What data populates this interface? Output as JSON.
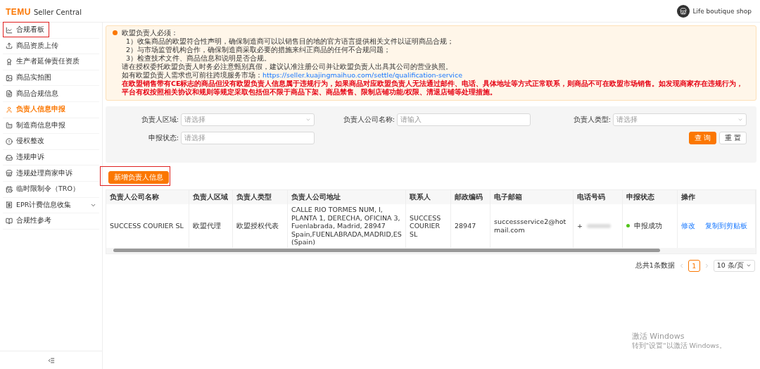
{
  "header": {
    "logo": "TEMU",
    "product": "Seller Central",
    "shop": "Life boutique shop"
  },
  "sidebar": {
    "items": [
      {
        "label": "合规看板",
        "selected": false,
        "highlighted": true
      },
      {
        "label": "商品资质上传",
        "selected": false,
        "highlighted": false
      },
      {
        "label": "生产者延伸责任资质",
        "selected": false,
        "highlighted": false
      },
      {
        "label": "商品实拍图",
        "selected": false,
        "highlighted": false
      },
      {
        "label": "商品合规信息",
        "selected": false,
        "highlighted": false
      },
      {
        "label": "负责人信息申报",
        "selected": true,
        "highlighted": false
      },
      {
        "label": "制造商信息申报",
        "selected": false,
        "highlighted": false
      },
      {
        "label": "侵权整改",
        "selected": false,
        "highlighted": false
      },
      {
        "label": "违规申诉",
        "selected": false,
        "highlighted": false
      },
      {
        "label": "违规处理商家申诉",
        "selected": false,
        "highlighted": false
      },
      {
        "label": "临时限制令（TRO）",
        "selected": false,
        "highlighted": false
      },
      {
        "label": "EPR计费信息收集",
        "selected": false,
        "highlighted": false,
        "expanded": false
      },
      {
        "label": "合规性参考",
        "selected": false,
        "highlighted": false
      }
    ]
  },
  "notice": {
    "title": "欧盟负责人必须：",
    "lines": [
      "1）收集商品的欧盟符合性声明，确保制造商可以以销售目的地的官方语言提供相关文件以证明商品合规；",
      "2）与市场监管机构合作，确保制造商采取必要的措施来纠正商品的任何不合规问题；",
      "3）检查技术文件、商品信息和说明是否合规。",
      "请在授权委托欧盟负责人时务必注意甄别真假，建议认准注册公司并让欧盟负责人出具其公司的营业执照。"
    ],
    "link_prefix": "如有欧盟负责人需求也可前往跨境服务市场：",
    "link": "https://seller.kuajingmaihuo.com/settle/qualification-service",
    "warning": "在欧盟销售带有CE标志的商品但没有欧盟负责人信息属于违规行为，如果商品对应欧盟负责人无法通过邮件、电话、具体地址等方式正常联系，则商品不可在欧盟市场销售。如发现商家存在违规行为，平台有权按照相关协议和规则等规定采取包括但不限于商品下架、商品禁售、限制店铺功能/权限、清退店铺等处理措施。"
  },
  "filters": [
    {
      "label": "负责人区域:",
      "placeholder": "请选择",
      "kind": "select"
    },
    {
      "label": "负责人公司名称:",
      "placeholder": "请输入",
      "kind": "input"
    },
    {
      "label": "负责人类型:",
      "placeholder": "请选择",
      "kind": "select"
    },
    {
      "label": "申报状态:",
      "placeholder": "请选择",
      "kind": "input"
    }
  ],
  "filter_buttons": [
    {
      "label": "查 询",
      "kind": "primary"
    },
    {
      "label": "重 置",
      "kind": "default"
    }
  ],
  "add_button": {
    "label": "新增负责人信息",
    "highlighted": true
  },
  "table": {
    "columns": [
      "负责人公司名称",
      "负责人区域",
      "负责人类型",
      "负责人公司地址",
      "联系人",
      "邮政编码",
      "电子邮箱",
      "电话号码",
      "申报状态",
      "操作"
    ],
    "rows": [
      {
        "company": "SUCCESS COURIER SL",
        "region": "欧盟代理",
        "type": "欧盟授权代表",
        "address": "CALLE RIO TORMES NUM, I, PLANTA 1, DERECHA, OFICINA 3, Fuenlabrada, Madrid, 28947 Spain,FUENLABRADA,MADRID,ES(Spain)",
        "contact": "SUCCESS COURIER SL",
        "zip": "28947",
        "email": "successservice2@hotmail.com",
        "phone": "+",
        "status": {
          "label": "申报成功",
          "kind": "success"
        },
        "actions": [
          "修改",
          "复制到剪贴板"
        ]
      }
    ]
  },
  "pagination": {
    "total": "总共1条数据",
    "pages": [
      {
        "label": "1",
        "selected": true
      }
    ],
    "page_size": "10 条/页"
  },
  "os_overlay": {
    "title": "激活 Windows",
    "subtitle": "转到\"设置\"以激活 Windows。"
  }
}
